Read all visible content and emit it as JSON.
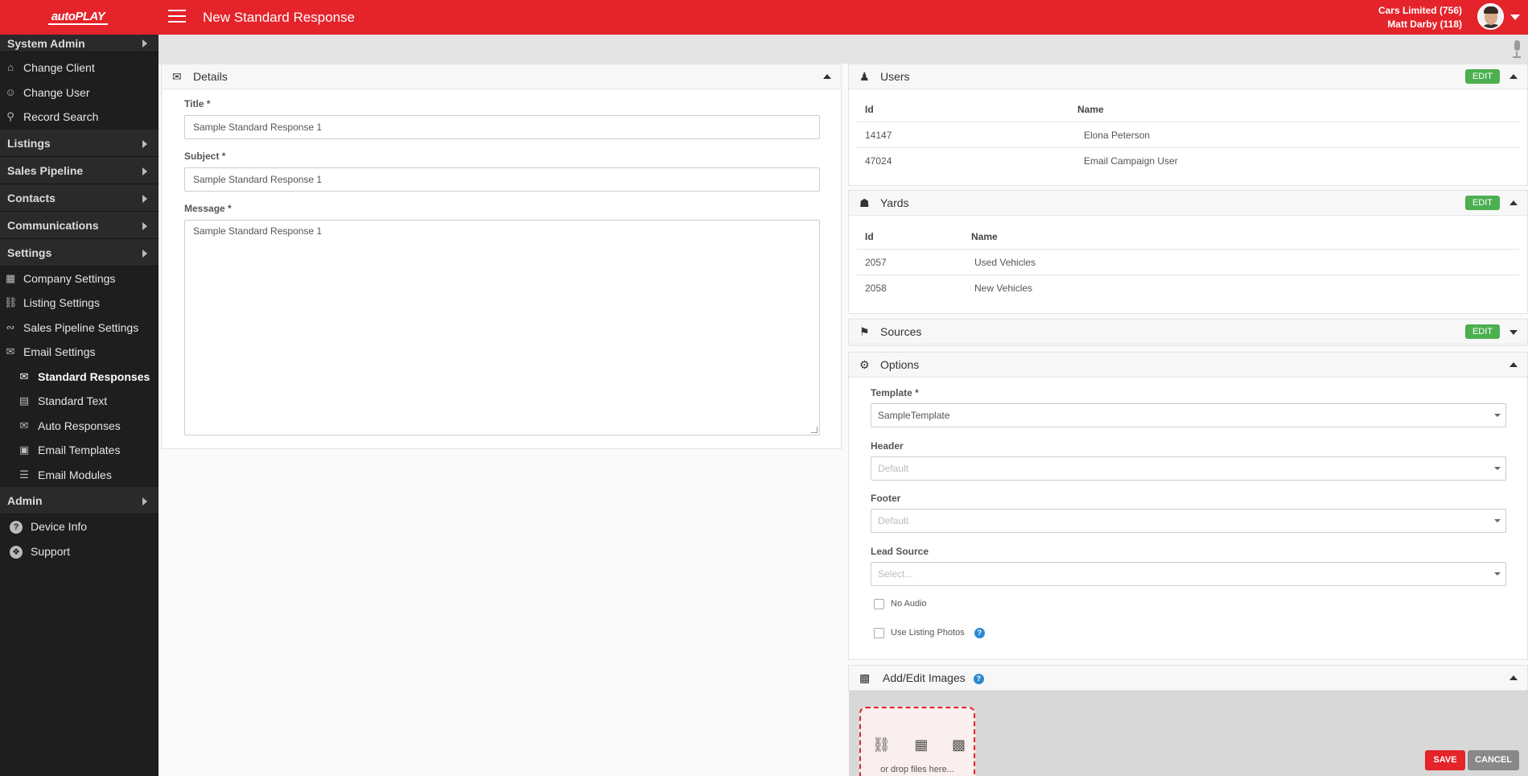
{
  "header": {
    "logo_text": "autoPLAY",
    "page_title": "New Standard Response",
    "account_client": "Cars Limited (756)",
    "account_user": "Matt Darby (118)"
  },
  "sidebar": {
    "system_admin": "System Admin",
    "change_client": "Change Client",
    "change_user": "Change User",
    "record_search": "Record Search",
    "listings": "Listings",
    "sales_pipeline": "Sales Pipeline",
    "contacts": "Contacts",
    "communications": "Communications",
    "settings": "Settings",
    "company_settings": "Company Settings",
    "listing_settings": "Listing Settings",
    "sales_pipeline_settings": "Sales Pipeline Settings",
    "email_settings": "Email Settings",
    "standard_responses": "Standard Responses",
    "standard_text": "Standard Text",
    "auto_responses": "Auto Responses",
    "email_templates": "Email Templates",
    "email_modules": "Email Modules",
    "admin": "Admin",
    "device_info": "Device Info",
    "support": "Support"
  },
  "details": {
    "heading": "Details",
    "title_label": "Title *",
    "title_value": "Sample Standard Response 1",
    "subject_label": "Subject *",
    "subject_value": "Sample Standard Response 1",
    "message_label": "Message *",
    "message_value": "Sample Standard Response 1"
  },
  "users": {
    "heading": "Users",
    "edit_label": "EDIT",
    "col_id": "Id",
    "col_name": "Name",
    "rows": [
      {
        "id": "14147",
        "name": "Elona Peterson"
      },
      {
        "id": "47024",
        "name": "Email Campaign User"
      }
    ]
  },
  "yards": {
    "heading": "Yards",
    "edit_label": "EDIT",
    "col_id": "Id",
    "col_name": "Name",
    "rows": [
      {
        "id": "2057",
        "name": "Used Vehicles"
      },
      {
        "id": "2058",
        "name": "New Vehicles"
      }
    ]
  },
  "sources": {
    "heading": "Sources",
    "edit_label": "EDIT"
  },
  "options": {
    "heading": "Options",
    "template_label": "Template *",
    "template_value": "SampleTemplate",
    "header_label": "Header",
    "header_placeholder": "Default",
    "footer_label": "Footer",
    "footer_placeholder": "Default",
    "lead_source_label": "Lead Source",
    "lead_source_placeholder": "Select...",
    "no_audio_label": "No Audio",
    "use_listing_photos_label": "Use Listing Photos"
  },
  "images": {
    "heading": "Add/Edit Images",
    "drop_text": "or drop files here..."
  },
  "actions": {
    "save_label": "SAVE",
    "cancel_label": "CANCEL"
  },
  "colors": {
    "brand_red": "#e4232a",
    "sidebar_bg": "#1e1e1e",
    "edit_green": "#4caf50",
    "help_blue": "#2a8ad0"
  }
}
